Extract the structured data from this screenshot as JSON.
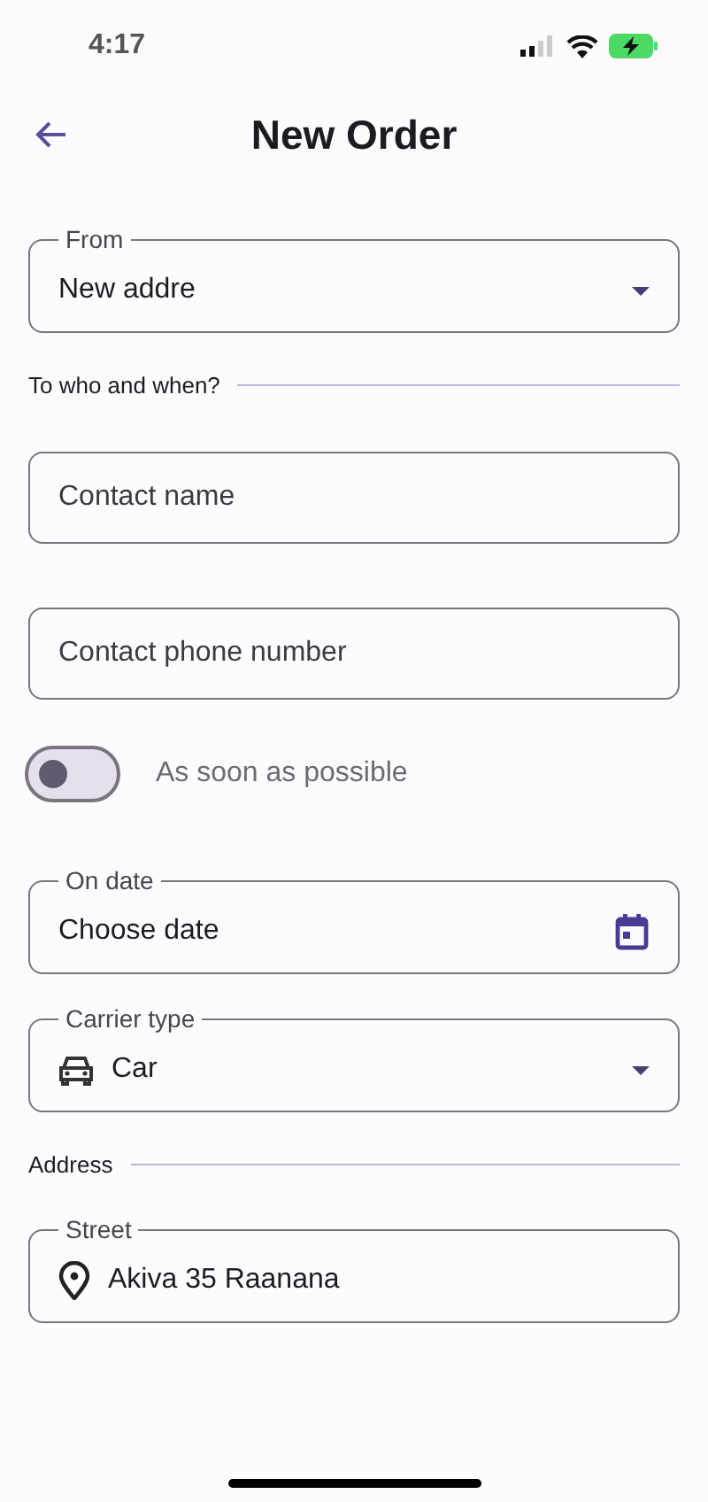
{
  "status_bar": {
    "time": "4:17"
  },
  "header": {
    "title": "New Order"
  },
  "form": [
    {
      "kind": "select",
      "label": "From",
      "value": "New addre"
    },
    {
      "kind": "section",
      "label": "To who and when?"
    },
    {
      "kind": "text",
      "placeholder": "Contact name"
    },
    {
      "kind": "text",
      "placeholder": "Contact phone number"
    },
    {
      "kind": "switch",
      "label": "As soon as possible",
      "on": false
    },
    {
      "kind": "date",
      "label": "On date",
      "value": "Choose date"
    },
    {
      "kind": "vehicle-select",
      "label": "Carrier type",
      "value": "Car"
    },
    {
      "kind": "section",
      "label": "Address"
    },
    {
      "kind": "location-text",
      "label": "Street",
      "value": "Akiva 35 Raanana"
    }
  ]
}
